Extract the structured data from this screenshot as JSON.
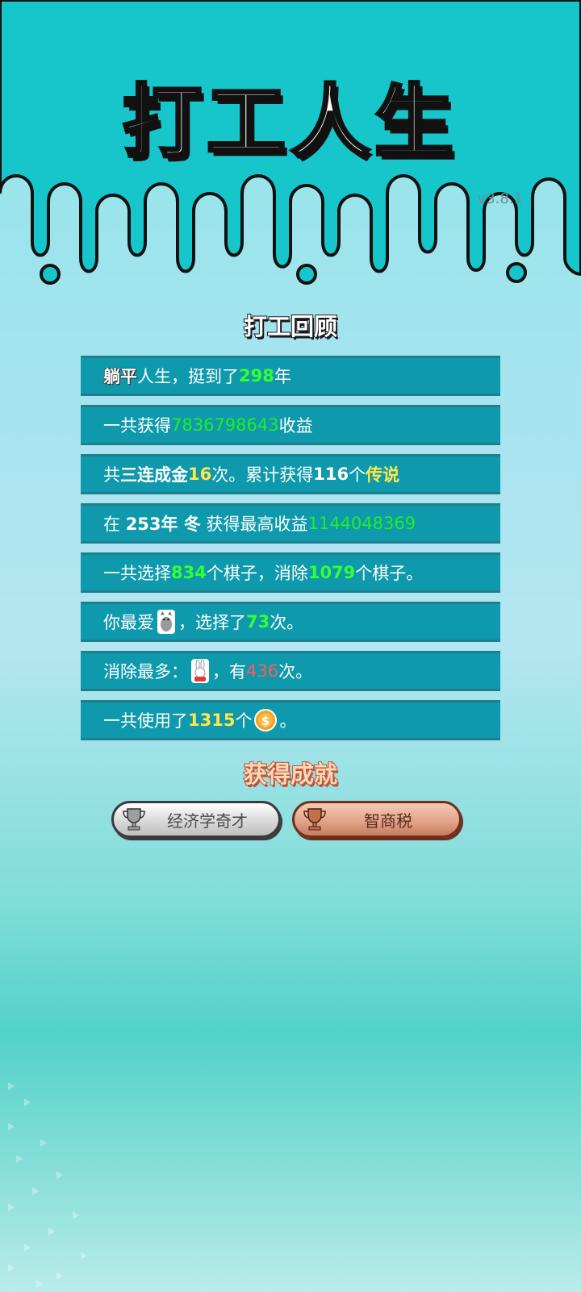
{
  "app": {
    "title": "打工人生",
    "version": "v3.8.1"
  },
  "review": {
    "title": "打工回顾",
    "row1": {
      "badge": "躺平",
      "t1": "人生，挺到了",
      "years": "298",
      "t2": "年"
    },
    "row2": {
      "t1": "一共获得",
      "income": "7836798643",
      "t2": "收益"
    },
    "row3": {
      "t1": "共",
      "combo": "三连成金",
      "times": "16",
      "t2": "次。累计获得",
      "count": "116",
      "t3": "个",
      "rarity": "传说"
    },
    "row4": {
      "t1": "在",
      "when": "253年 冬",
      "t2": "获得最高收益",
      "best": "1144048369"
    },
    "row5": {
      "t1": "一共选择",
      "chosen": "834",
      "t2": "个棋子，消除",
      "cleared": "1079",
      "t3": "个棋子。"
    },
    "row6": {
      "t1": "你最爱",
      "fav_icon": "cat-piece-icon",
      "t2": "，选择了",
      "times": "73",
      "t3": "次。"
    },
    "row7": {
      "t1": "消除最多：",
      "icon": "rabbit-piece-icon",
      "t2": "，有",
      "times": "436",
      "t3": "次。"
    },
    "row8": {
      "t1": "一共使用了",
      "coins": "1315",
      "t2": "个",
      "icon": "coin-icon",
      "t3": "。"
    }
  },
  "achievements": {
    "title": "获得成就",
    "items": [
      {
        "label": "经济学奇才",
        "tier": "silver",
        "icon": "silver-trophy-icon"
      },
      {
        "label": "智商税",
        "tier": "bronze",
        "icon": "bronze-trophy-icon"
      }
    ]
  },
  "colors": {
    "row_bg": "#0e9aac",
    "highlight_green": "#33ff33",
    "highlight_yellow": "#ffe84a",
    "highlight_red": "#ff5b5b",
    "top_band": "#16c6cb"
  }
}
